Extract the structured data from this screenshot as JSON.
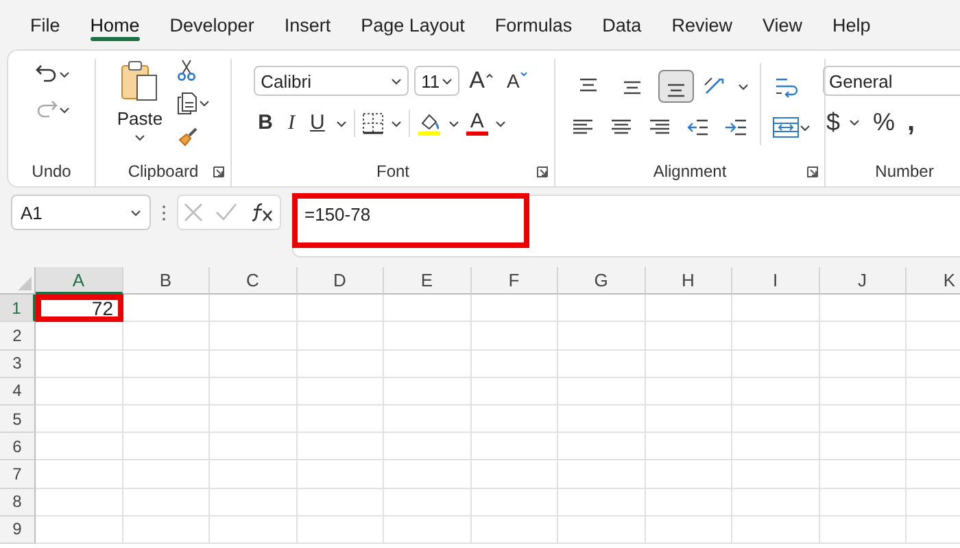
{
  "menu_tabs": [
    {
      "label": "File",
      "selected": false
    },
    {
      "label": "Home",
      "selected": true
    },
    {
      "label": "Developer",
      "selected": false
    },
    {
      "label": "Insert",
      "selected": false
    },
    {
      "label": "Page Layout",
      "selected": false
    },
    {
      "label": "Formulas",
      "selected": false
    },
    {
      "label": "Data",
      "selected": false
    },
    {
      "label": "Review",
      "selected": false
    },
    {
      "label": "View",
      "selected": false
    },
    {
      "label": "Help",
      "selected": false
    }
  ],
  "ribbon": {
    "groups": [
      {
        "kind": "undo",
        "label": "Undo",
        "launcher": false
      },
      {
        "kind": "clipboard",
        "label": "Clipboard",
        "launcher": true
      },
      {
        "kind": "font",
        "label": "Font",
        "launcher": true
      },
      {
        "kind": "alignment",
        "label": "Alignment",
        "launcher": true
      },
      {
        "kind": "number",
        "label": "Number",
        "launcher": false
      }
    ]
  },
  "undo": {
    "undo_disabled": false,
    "redo_disabled": true
  },
  "clipboard": {
    "paste_label": "Paste"
  },
  "font": {
    "name": "Calibri",
    "size": "11",
    "grow_label": "A",
    "shrink_label": "A",
    "bold_label": "B",
    "italic_label": "I",
    "underline_label": "U",
    "color_label": "A"
  },
  "alignment": {
    "vertical": [
      {
        "selected": false
      },
      {
        "selected": false
      },
      {
        "selected": true
      }
    ]
  },
  "number": {
    "format": "General",
    "currency_label": "$",
    "percent_label": "%",
    "comma_label": ","
  },
  "formula_bar": {
    "name_box": "A1",
    "formula": "=150-78",
    "highlighted": true
  },
  "sheet": {
    "columns": [
      {
        "label": "A",
        "selected": true
      },
      {
        "label": "B",
        "selected": false
      },
      {
        "label": "C",
        "selected": false
      },
      {
        "label": "D",
        "selected": false
      },
      {
        "label": "E",
        "selected": false
      },
      {
        "label": "F",
        "selected": false
      },
      {
        "label": "G",
        "selected": false
      },
      {
        "label": "H",
        "selected": false
      },
      {
        "label": "I",
        "selected": false
      },
      {
        "label": "J",
        "selected": false
      },
      {
        "label": "K",
        "selected": false
      }
    ],
    "rows": [
      {
        "label": "1",
        "selected": true,
        "cells": [
          {
            "value": "72",
            "highlighted": true
          }
        ]
      },
      {
        "label": "2",
        "selected": false,
        "cells": []
      },
      {
        "label": "3",
        "selected": false,
        "cells": []
      },
      {
        "label": "4",
        "selected": false,
        "cells": []
      },
      {
        "label": "5",
        "selected": false,
        "cells": []
      },
      {
        "label": "6",
        "selected": false,
        "cells": []
      },
      {
        "label": "7",
        "selected": false,
        "cells": []
      },
      {
        "label": "8",
        "selected": false,
        "cells": []
      },
      {
        "label": "9",
        "selected": false,
        "cells": []
      }
    ]
  }
}
